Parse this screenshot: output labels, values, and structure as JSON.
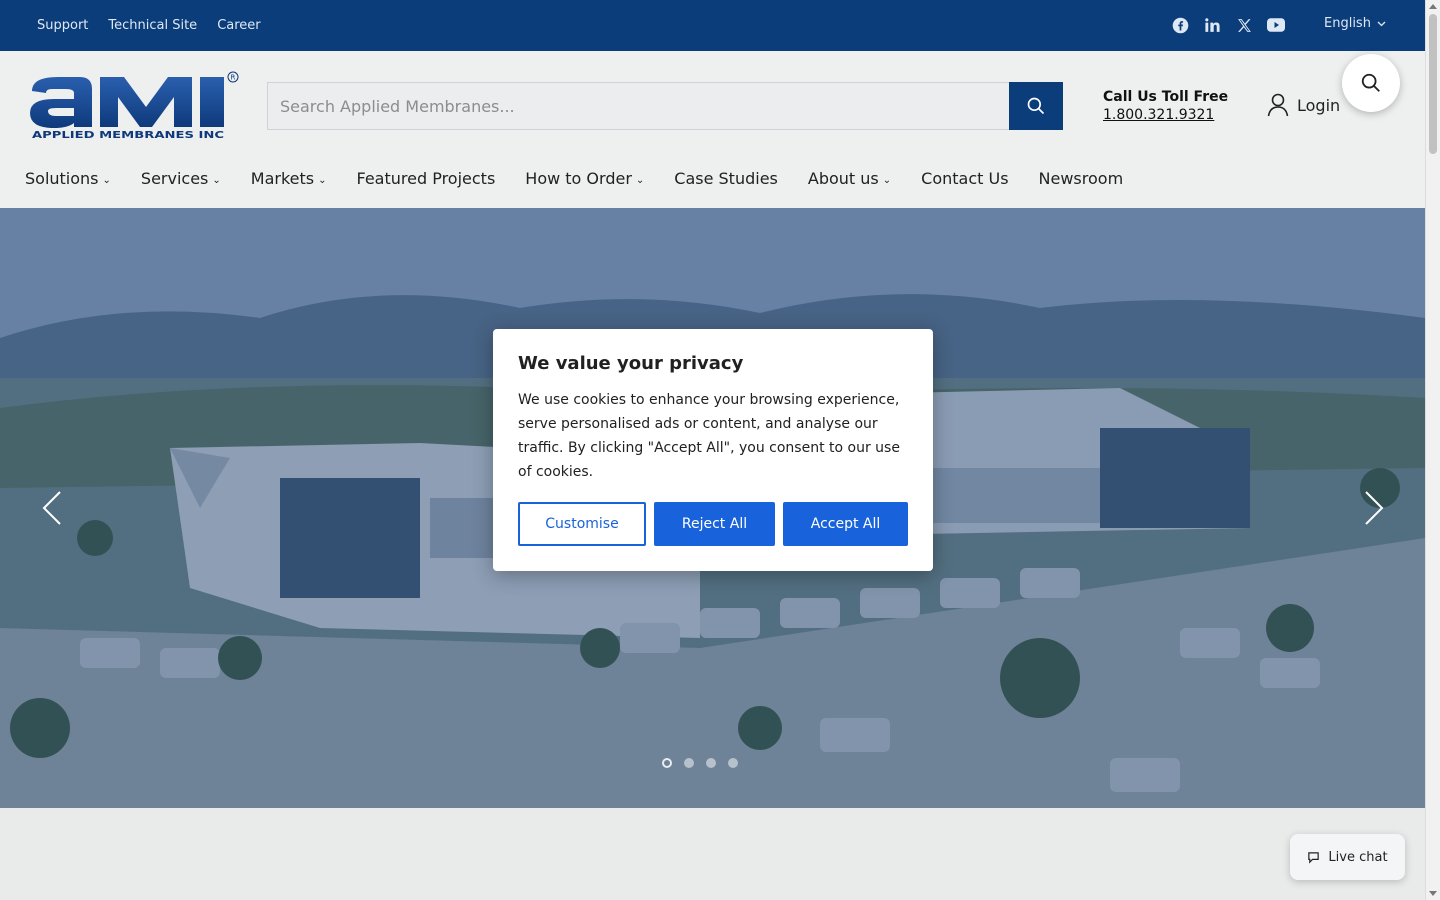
{
  "topbar": {
    "links": [
      "Support",
      "Technical Site",
      "Career"
    ],
    "social_icons": [
      "facebook-icon",
      "linkedin-icon",
      "x-icon",
      "youtube-icon"
    ],
    "language": "English"
  },
  "header": {
    "logo_text": "ami",
    "logo_subtext": "APPLIED MEMBRANES INC",
    "search_placeholder": "Search Applied Membranes...",
    "call_label": "Call Us Toll Free",
    "phone": "1.800.321.9321",
    "login_label": "Login"
  },
  "nav": {
    "items": [
      {
        "label": "Solutions",
        "dropdown": true
      },
      {
        "label": "Services",
        "dropdown": true
      },
      {
        "label": "Markets",
        "dropdown": true
      },
      {
        "label": "Featured Projects",
        "dropdown": false
      },
      {
        "label": "How to Order",
        "dropdown": true
      },
      {
        "label": "Case Studies",
        "dropdown": false
      },
      {
        "label": "About us",
        "dropdown": true
      },
      {
        "label": "Contact Us",
        "dropdown": false
      },
      {
        "label": "Newsroom",
        "dropdown": false
      }
    ]
  },
  "hero": {
    "slide_count": 4,
    "active_slide": 1
  },
  "cookie_modal": {
    "title": "We value your privacy",
    "body": "We use cookies to enhance your browsing experience, serve personalised ads or content, and analyse our traffic. By clicking \"Accept All\", you consent to our use of cookies.",
    "customise": "Customise",
    "reject": "Reject All",
    "accept": "Accept All"
  },
  "livechat": {
    "label": "Live chat"
  },
  "colors": {
    "brand_navy": "#0b3d7a",
    "button_blue": "#1863dc"
  }
}
